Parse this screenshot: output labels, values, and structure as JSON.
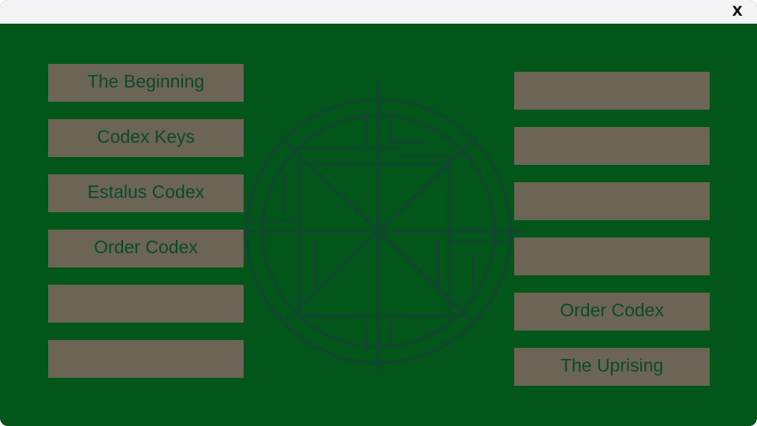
{
  "window": {
    "close_label": "X"
  },
  "colors": {
    "background": "#03561a",
    "titlebar": "#f4f4f6",
    "button_fill": "#6c6556",
    "button_text": "#0a4a2a",
    "emblem_stroke": "#0c4a2a"
  },
  "emblem": {
    "icon": "rune-compass-icon"
  },
  "left_column": {
    "items": [
      {
        "label": "The Beginning"
      },
      {
        "label": "Codex Keys"
      },
      {
        "label": "Estalus Codex"
      },
      {
        "label": "Order Codex"
      },
      {
        "label": ""
      },
      {
        "label": ""
      }
    ]
  },
  "right_column": {
    "items": [
      {
        "label": ""
      },
      {
        "label": ""
      },
      {
        "label": ""
      },
      {
        "label": ""
      },
      {
        "label": "Order Codex"
      },
      {
        "label": "The Uprising"
      }
    ]
  }
}
